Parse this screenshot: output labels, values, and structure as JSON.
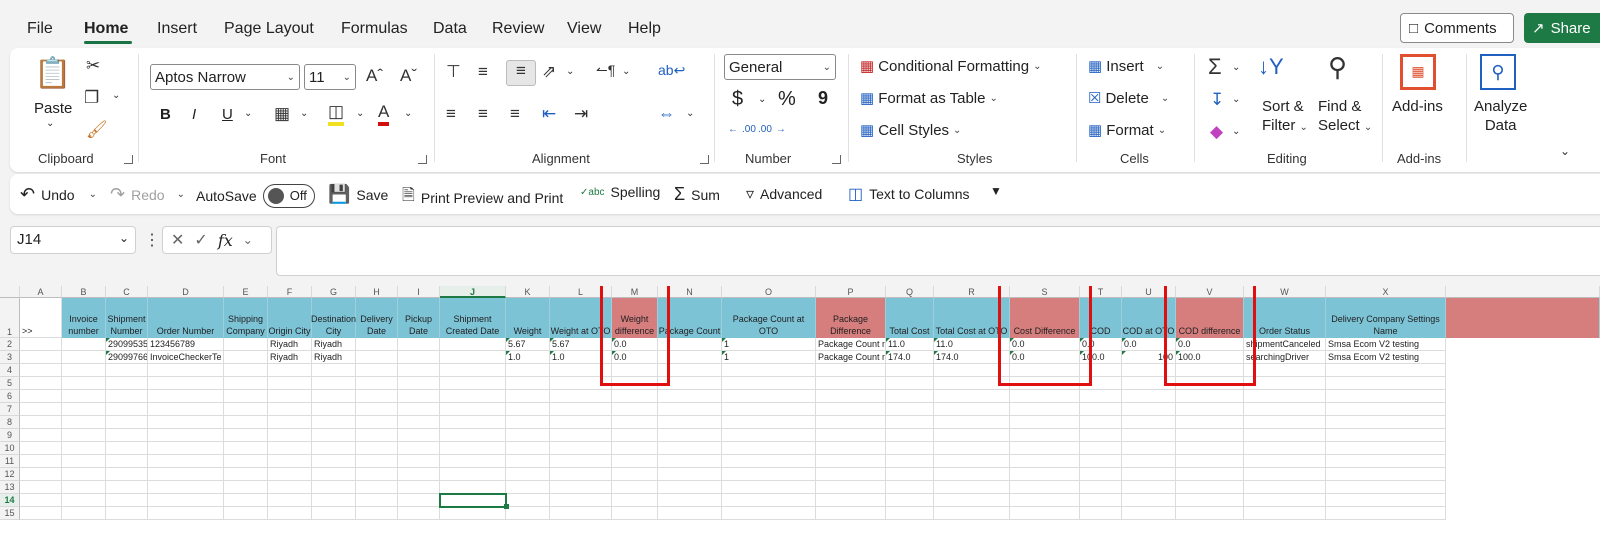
{
  "menu": {
    "items": [
      "File",
      "Home",
      "Insert",
      "Page Layout",
      "Formulas",
      "Data",
      "Review",
      "View",
      "Help"
    ],
    "comments": "Comments",
    "share": "Share"
  },
  "ribbon": {
    "clipboard": {
      "paste": "Paste",
      "label": "Clipboard"
    },
    "font": {
      "name": "Aptos Narrow",
      "size": "11",
      "label": "Font",
      "bold": "B",
      "italic": "I",
      "underline": "U"
    },
    "alignment": {
      "label": "Alignment"
    },
    "number": {
      "format": "General",
      "currency": "$",
      "percent": "%",
      "comma": "9",
      "inc_decimal": ".00",
      "dec_decimal": ".00",
      "label": "Number"
    },
    "styles": {
      "conditional": "Conditional Formatting",
      "format_table": "Format as Table",
      "cell_styles": "Cell Styles",
      "label": "Styles"
    },
    "cells": {
      "insert": "Insert",
      "delete": "Delete",
      "format": "Format",
      "label": "Cells"
    },
    "editing": {
      "sort1": "Sort &",
      "sort2": "Filter",
      "find1": "Find &",
      "find2": "Select",
      "label": "Editing"
    },
    "addins": {
      "btn": "Add-ins",
      "label": "Add-ins"
    },
    "analyze": {
      "line1": "Analyze",
      "line2": "Data"
    }
  },
  "qat": {
    "undo": "Undo",
    "redo": "Redo",
    "autosave": "AutoSave",
    "autosave_state": "Off",
    "save": "Save",
    "print": "Print Preview and Print",
    "spelling": "Spelling",
    "spelling_badge": "abc",
    "sum": "Sum",
    "advanced": "Advanced",
    "text_to_columns": "Text to Columns"
  },
  "formula_bar": {
    "name_box": "J14",
    "fx": "fx",
    "content": ""
  },
  "sheet": {
    "columns": [
      "A",
      "B",
      "C",
      "D",
      "E",
      "F",
      "G",
      "H",
      "I",
      "J",
      "K",
      "L",
      "M",
      "N",
      "O",
      "P",
      "Q",
      "R",
      "S",
      "T",
      "U",
      "V",
      "W",
      "X"
    ],
    "rows": [
      "1",
      "2",
      "3",
      "4",
      "5",
      "6",
      "7",
      "8",
      "9",
      "10",
      "11",
      "12",
      "13",
      "14",
      "15"
    ],
    "row1_marker": ">>",
    "headers": [
      "Invoice number",
      "Shipment Number",
      "Order Number",
      "Shipping Company",
      "Origin City",
      "Destination City",
      "Delivery Date",
      "Pickup Date",
      "Shipment Created Date",
      "Weight",
      "Weight at OTO",
      "Weight difference",
      "Package Count",
      "Package Count at OTO",
      "Package Difference",
      "Total Cost",
      "Total Cost at OTO",
      "Cost Difference",
      "COD",
      "COD at OTO",
      "COD difference",
      "Order Status",
      "Delivery Company Settings Name"
    ],
    "row2": [
      "",
      "29099535",
      "123456789",
      "",
      "Riyadh",
      "Riyadh",
      "",
      "",
      "",
      "5.67",
      "5.67",
      "0.0",
      "",
      "1",
      "Package Count n",
      "11.0",
      "11.0",
      "0.0",
      "0.0",
      "0.0",
      "0.0",
      "shipmentCanceled",
      "Smsa Ecom V2 testing"
    ],
    "row3": [
      "",
      "29099766",
      "InvoiceCheckerTe",
      "",
      "Riyadh",
      "Riyadh",
      "",
      "",
      "",
      "1.0",
      "1.0",
      "0.0",
      "",
      "1",
      "Package Count n",
      "174.0",
      "174.0",
      "0.0",
      "100.0",
      "100",
      "100.0",
      "searchingDriver",
      "Smsa Ecom V2 testing"
    ]
  },
  "colors": {
    "header_blue": "#7cc3d6",
    "header_red": "#d67d7d",
    "accent_green": "#1e7a45",
    "highlight_red": "#e01010"
  }
}
